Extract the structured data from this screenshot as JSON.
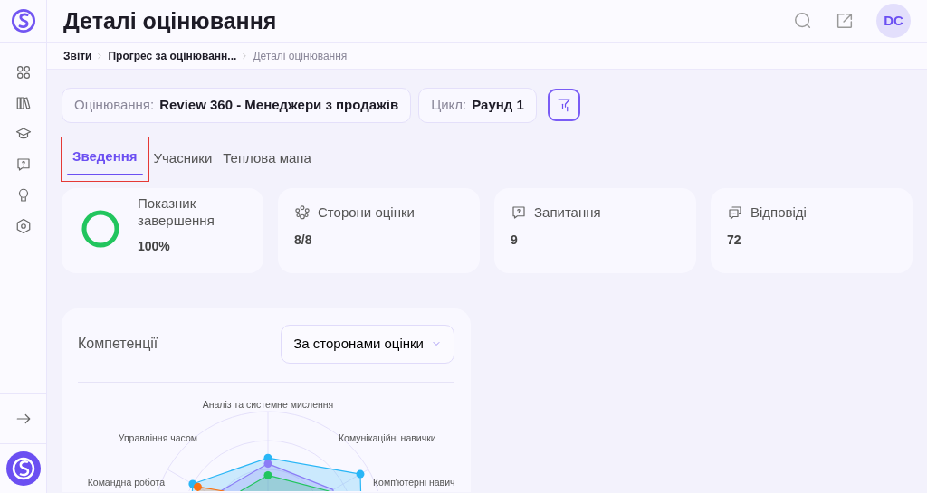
{
  "header": {
    "title": "Деталі оцінювання",
    "avatar": "DC"
  },
  "breadcrumbs": [
    {
      "label": "Звіти",
      "current": false
    },
    {
      "label": "Прогрес за оцінюванн...",
      "current": false
    },
    {
      "label": "Деталі оцінювання",
      "current": true
    }
  ],
  "filters": [
    {
      "label": "Оцінювання:",
      "value": "Review 360 - Менеджери з продажів"
    },
    {
      "label": "Цикл:",
      "value": "Раунд 1"
    }
  ],
  "tabs": [
    {
      "label": "Зведення",
      "selected": true,
      "highlighted": true
    },
    {
      "label": "Учасники",
      "selected": false,
      "highlighted": false
    },
    {
      "label": "Теплова мапа",
      "selected": false,
      "highlighted": false
    }
  ],
  "stats": [
    {
      "kind": "progress",
      "title": "Показник завершення",
      "value": "100%",
      "level": 1
    },
    {
      "kind": "raters",
      "title": "Сторони оцінки",
      "value": "8/8"
    },
    {
      "kind": "questions",
      "title": "Запитання",
      "value": "9"
    },
    {
      "kind": "answers",
      "title": "Відповіді",
      "value": "72"
    }
  ],
  "competencies": {
    "title": "Компетенції",
    "view": "За сторонами оцінки",
    "axes": [
      "Аналіз та системне мислення",
      "Управління часом",
      "Комунікаційні навички",
      "Командна робота",
      "Комп'ютерні навич"
    ]
  }
}
